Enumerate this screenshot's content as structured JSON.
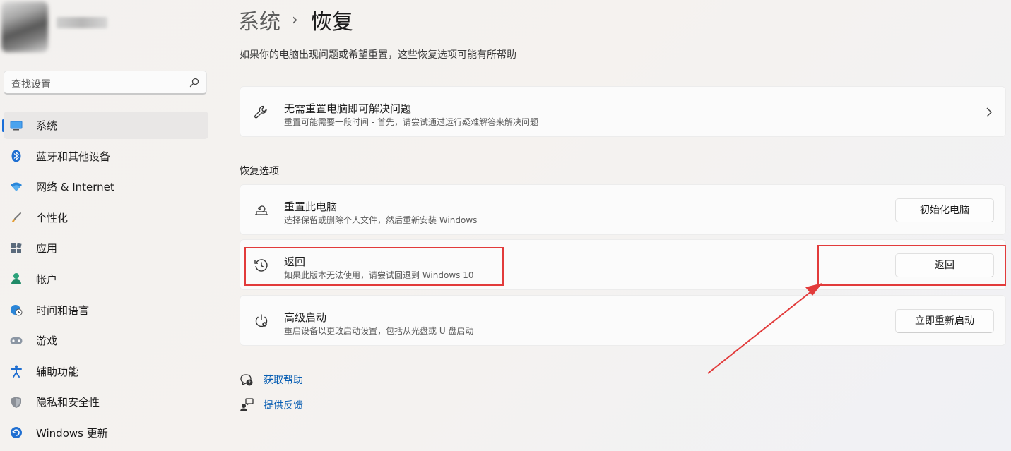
{
  "sidebar": {
    "search_placeholder": "查找设置",
    "items": [
      {
        "label": "系统",
        "icon": "monitor-icon",
        "active": true
      },
      {
        "label": "蓝牙和其他设备",
        "icon": "bluetooth-icon"
      },
      {
        "label": "网络 & Internet",
        "icon": "wifi-icon"
      },
      {
        "label": "个性化",
        "icon": "brush-icon"
      },
      {
        "label": "应用",
        "icon": "apps-icon"
      },
      {
        "label": "帐户",
        "icon": "person-icon"
      },
      {
        "label": "时间和语言",
        "icon": "globe-clock-icon"
      },
      {
        "label": "游戏",
        "icon": "gamepad-icon"
      },
      {
        "label": "辅助功能",
        "icon": "accessibility-icon"
      },
      {
        "label": "隐私和安全性",
        "icon": "shield-icon"
      },
      {
        "label": "Windows 更新",
        "icon": "update-icon"
      }
    ]
  },
  "header": {
    "parent": "系统",
    "separator": "›",
    "current": "恢复",
    "subtitle": "如果你的电脑出现问题或希望重置，这些恢复选项可能有所帮助"
  },
  "troubleshoot_card": {
    "title": "无需重置电脑即可解决问题",
    "description": "重置可能需要一段时间 - 首先，请尝试通过运行疑难解答来解决问题",
    "icon": "wrench-icon"
  },
  "recovery_section": {
    "title": "恢复选项",
    "options": [
      {
        "title": "重置此电脑",
        "description": "选择保留或删除个人文件，然后重新安装 Windows",
        "button": "初始化电脑",
        "icon": "reset-pc-icon"
      },
      {
        "title": "返回",
        "description": "如果此版本无法使用，请尝试回退到 Windows 10",
        "button": "返回",
        "icon": "history-icon"
      },
      {
        "title": "高级启动",
        "description": "重启设备以更改启动设置，包括从光盘或 U 盘启动",
        "button": "立即重新启动",
        "icon": "advanced-startup-icon"
      }
    ]
  },
  "links": [
    {
      "label": "获取帮助",
      "icon": "help-icon"
    },
    {
      "label": "提供反馈",
      "icon": "feedback-icon"
    }
  ],
  "colors": {
    "accent": "#1a6ed8",
    "highlight": "#e23b3b",
    "link": "#0a5fb3"
  }
}
